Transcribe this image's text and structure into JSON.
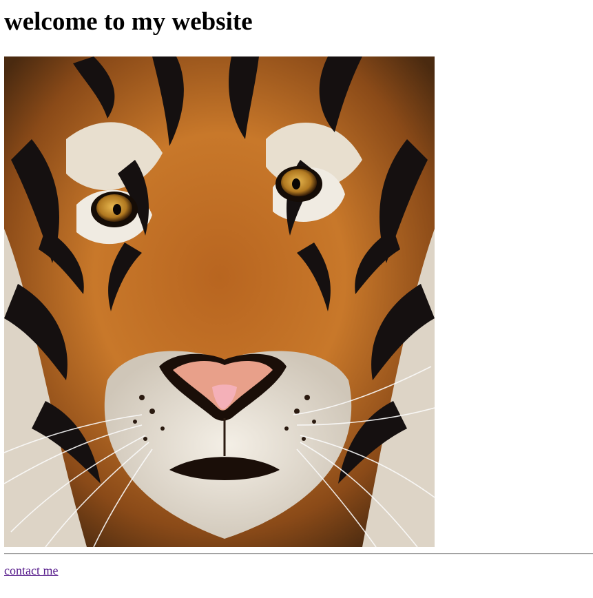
{
  "page": {
    "heading": "welcome to my website",
    "link_label": "contact me"
  },
  "image": {
    "subject": "tiger-face",
    "colors": {
      "fur_orange": "#c8782a",
      "fur_dark": "#3a2010",
      "fur_white": "#ece6dc",
      "stripe": "#151010",
      "eye": "#c08a2a",
      "nose": "#e8a08a"
    }
  },
  "colors": {
    "visited_link": "#551a8b",
    "rule": "#9a9a9a"
  }
}
